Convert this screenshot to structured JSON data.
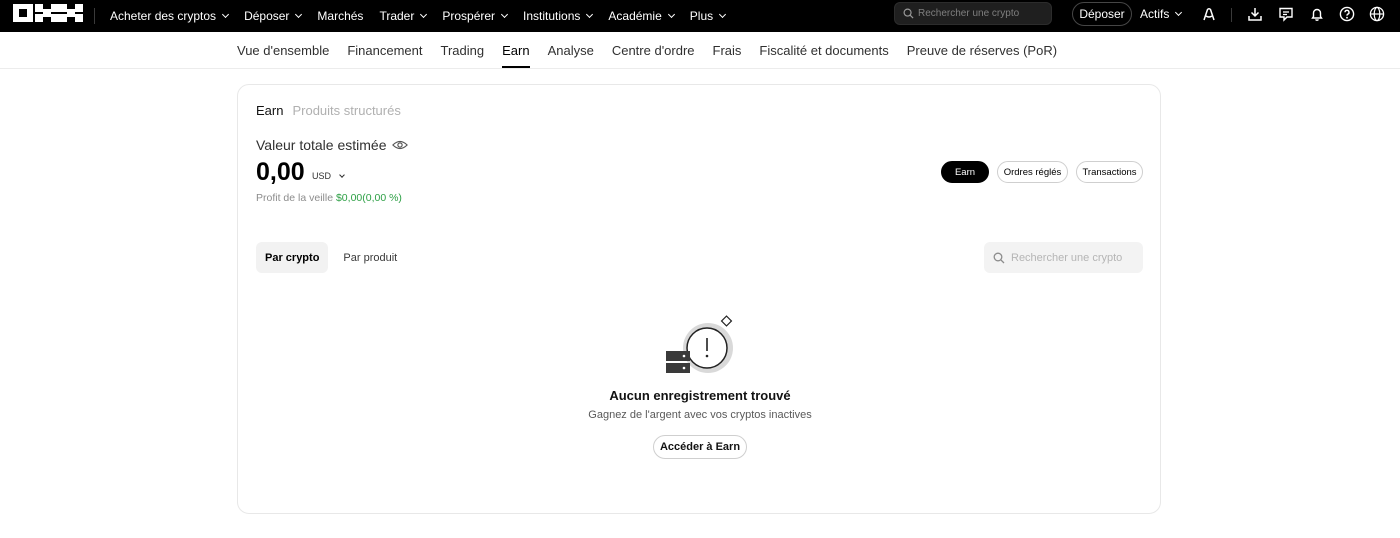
{
  "topnav": {
    "items": [
      {
        "label": "Acheter des cryptos",
        "dropdown": true
      },
      {
        "label": "Déposer",
        "dropdown": true
      },
      {
        "label": "Marchés",
        "dropdown": false
      },
      {
        "label": "Trader",
        "dropdown": true
      },
      {
        "label": "Prospérer",
        "dropdown": true
      },
      {
        "label": "Institutions",
        "dropdown": true
      },
      {
        "label": "Académie",
        "dropdown": true
      },
      {
        "label": "Plus",
        "dropdown": true
      }
    ],
    "search_placeholder": "Rechercher une crypto",
    "deposit_label": "Déposer",
    "assets_label": "Actifs",
    "icons": [
      "user-icon",
      "download-icon",
      "chat-icon",
      "bell-icon",
      "help-icon",
      "globe-icon"
    ]
  },
  "subnav": {
    "items": [
      "Vue d'ensemble",
      "Financement",
      "Trading",
      "Earn",
      "Analyse",
      "Centre d'ordre",
      "Frais",
      "Fiscalité et documents",
      "Preuve de réserves (PoR)"
    ],
    "active": "Earn"
  },
  "card": {
    "tabs": [
      "Earn",
      "Produits structurés"
    ],
    "active_tab": "Earn",
    "total_label": "Valeur totale estimée",
    "total_value": "0,00",
    "currency": "USD",
    "profit_label": "Profit de la veille",
    "profit_value": "$0,00(0,00 %)",
    "pills": {
      "earn": "Earn",
      "orders": "Ordres réglés",
      "transactions": "Transactions"
    },
    "segments": [
      "Par crypto",
      "Par produit"
    ],
    "active_segment": "Par crypto",
    "search_placeholder": "Rechercher une crypto",
    "empty": {
      "title": "Aucun enregistrement trouvé",
      "subtitle": "Gagnez de l'argent avec vos cryptos inactives",
      "button": "Accéder à Earn"
    }
  },
  "colors": {
    "topbar": "#000000",
    "profit_green": "#2ea046",
    "accent": "#000000"
  }
}
